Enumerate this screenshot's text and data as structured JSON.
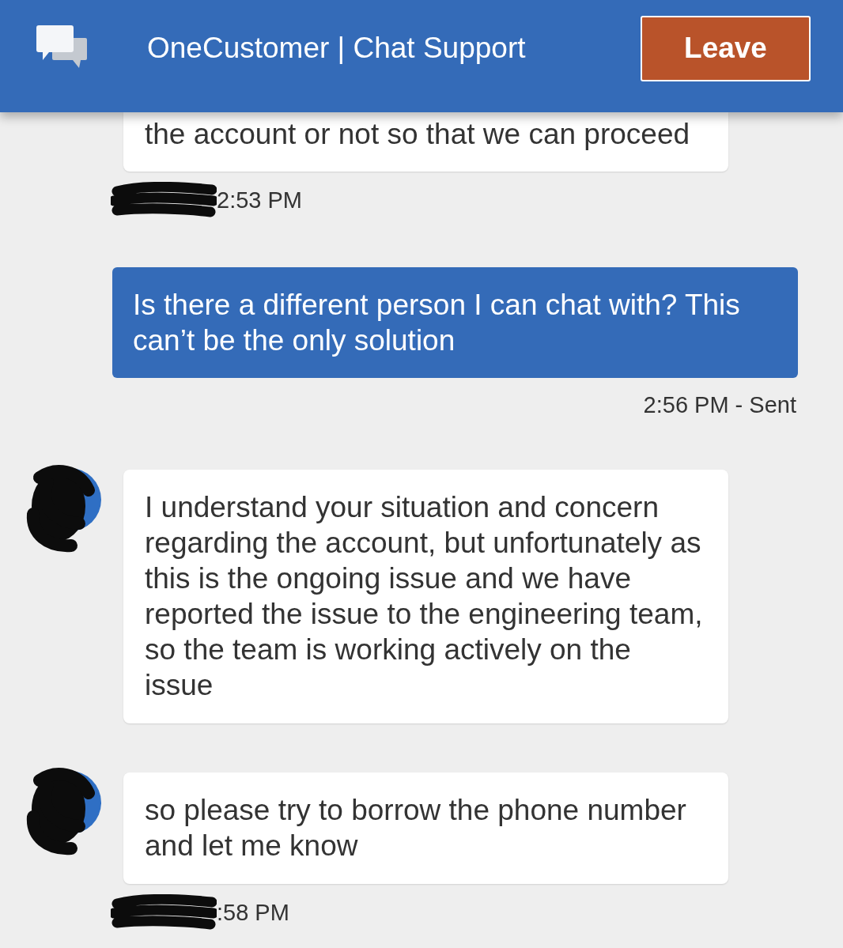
{
  "header": {
    "title": "OneCustomer | Chat Support",
    "leave_button": "Leave"
  },
  "messages": [
    {
      "kind": "agent",
      "cut_off": true,
      "avatar": false,
      "text": "the account or not so that we can proceed",
      "time": "2:53 PM",
      "time_redacted": true
    },
    {
      "kind": "user",
      "cut_off": false,
      "text": "Is there a different person I can chat with? This can’t be the only solution",
      "time": "2:56 PM - Sent",
      "time_redacted": false
    },
    {
      "kind": "agent",
      "cut_off": false,
      "avatar": true,
      "text": "I understand your situation and concern regarding the account, but unfortunately as this is the ongoing issue and we have reported the issue to the engineering team, so the team is working actively on the issue",
      "time_redacted": false
    },
    {
      "kind": "agent",
      "cut_off": false,
      "avatar": true,
      "text": "so please try to borrow the phone number and let me know",
      "time": ":58 PM",
      "time_redacted": true
    }
  ]
}
